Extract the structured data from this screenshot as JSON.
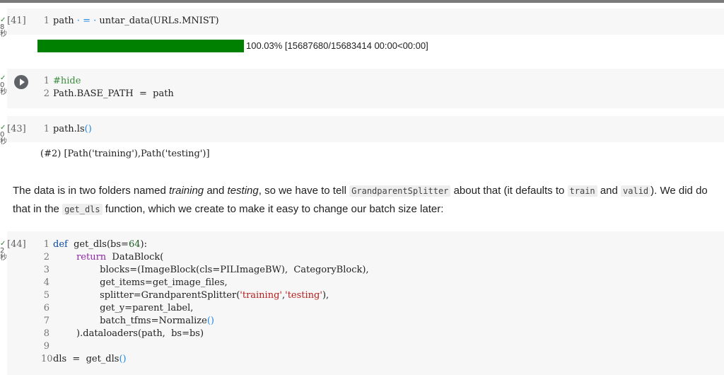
{
  "gutter": [
    {
      "check": "✓",
      "num": "8",
      "unit": "秒"
    },
    {
      "check": "✓",
      "num": "0",
      "unit": "秒"
    },
    {
      "check": "✓",
      "num": "0",
      "unit": "秒"
    },
    {
      "check": "✓",
      "num": "2",
      "unit": "秒"
    }
  ],
  "cell41": {
    "exec": "[41]",
    "lines": [
      {
        "n": "1",
        "parts": [
          {
            "t": "path",
            "c": ""
          },
          {
            "t": " · = · ",
            "c": "pn"
          },
          {
            "t": "untar_data(URLs.MNIST)",
            "c": ""
          }
        ]
      }
    ],
    "progress": {
      "fraction": 1.0,
      "text": "100.03% [15687680/15683414 00:00<00:00]"
    }
  },
  "cell42": {
    "lines": [
      {
        "n": "1",
        "parts": [
          {
            "t": "#hide",
            "c": "cm"
          }
        ]
      },
      {
        "n": "2",
        "parts": [
          {
            "t": "Path.BASE_PATH  =  path",
            "c": ""
          }
        ]
      }
    ]
  },
  "cell43": {
    "exec": "[43]",
    "lines": [
      {
        "n": "1",
        "parts": [
          {
            "t": "path.ls",
            "c": ""
          },
          {
            "t": "()",
            "c": "pn"
          }
        ]
      }
    ],
    "output": "(#2) [Path('training'),Path('testing')]"
  },
  "markdown": {
    "p1": "The data is in two folders named ",
    "em1": "training",
    "p2": " and ",
    "em2": "testing",
    "p3": ", so we have to tell ",
    "code1": "GrandparentSplitter",
    "p4": " about that (it defaults to ",
    "code2": "train",
    "p5": " and ",
    "code3": "valid",
    "p6": "). We did do that in the ",
    "code4": "get_dls",
    "p7": " function, which we create to make it easy to change our batch size later:"
  },
  "cell44": {
    "exec": "[44]",
    "lines": [
      {
        "n": "1",
        "parts": [
          {
            "t": "def",
            "c": "kw"
          },
          {
            "t": "  get_dls(bs=",
            "c": ""
          },
          {
            "t": "64",
            "c": "num"
          },
          {
            "t": "):",
            "c": ""
          }
        ]
      },
      {
        "n": "2",
        "parts": [
          {
            "t": "        ",
            "c": ""
          },
          {
            "t": "return",
            "c": "kw2"
          },
          {
            "t": "  DataBlock(",
            "c": ""
          }
        ]
      },
      {
        "n": "3",
        "parts": [
          {
            "t": "                blocks=(ImageBlock(cls=PILImageBW),  CategoryBlock),",
            "c": ""
          }
        ]
      },
      {
        "n": "4",
        "parts": [
          {
            "t": "                get_items=get_image_files,",
            "c": ""
          }
        ]
      },
      {
        "n": "5",
        "parts": [
          {
            "t": "                splitter=GrandparentSplitter(",
            "c": ""
          },
          {
            "t": "'training'",
            "c": "str"
          },
          {
            "t": ",",
            "c": ""
          },
          {
            "t": "'testing'",
            "c": "str"
          },
          {
            "t": "),",
            "c": ""
          }
        ]
      },
      {
        "n": "6",
        "parts": [
          {
            "t": "                get_y=parent_label,",
            "c": ""
          }
        ]
      },
      {
        "n": "7",
        "parts": [
          {
            "t": "                batch_tfms=Normalize",
            "c": ""
          },
          {
            "t": "()",
            "c": "pn"
          }
        ]
      },
      {
        "n": "8",
        "parts": [
          {
            "t": "        ).dataloaders(path,  bs=bs)",
            "c": ""
          }
        ]
      },
      {
        "n": "9",
        "parts": [
          {
            "t": "",
            "c": ""
          }
        ]
      },
      {
        "n": "10",
        "parts": [
          {
            "t": "dls  =  get_dls",
            "c": ""
          },
          {
            "t": "()",
            "c": "pn"
          }
        ]
      }
    ]
  }
}
